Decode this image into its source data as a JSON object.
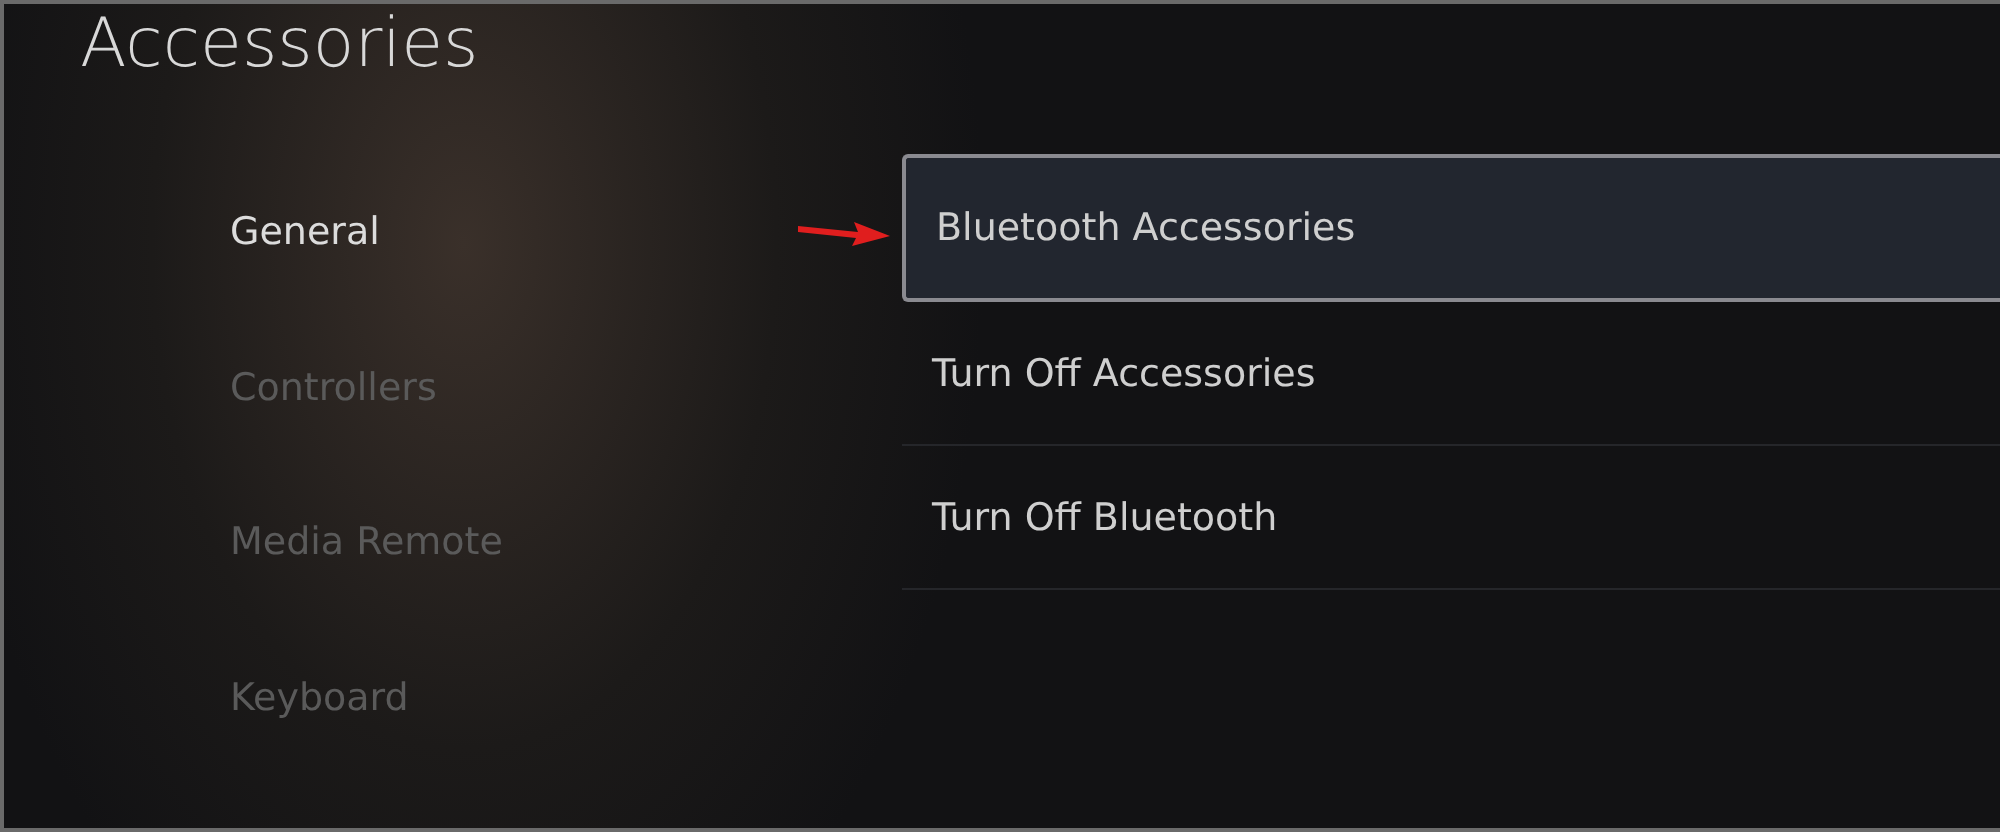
{
  "title": "Accessories",
  "sidebar": {
    "items": [
      {
        "label": "General",
        "selected": true
      },
      {
        "label": "Controllers",
        "selected": false
      },
      {
        "label": "Media Remote",
        "selected": false
      },
      {
        "label": "Keyboard",
        "selected": false
      }
    ]
  },
  "menu": {
    "items": [
      {
        "label": "Bluetooth Accessories",
        "selected": true
      },
      {
        "label": "Turn Off Accessories",
        "selected": false
      },
      {
        "label": "Turn Off Bluetooth",
        "selected": false
      }
    ]
  }
}
